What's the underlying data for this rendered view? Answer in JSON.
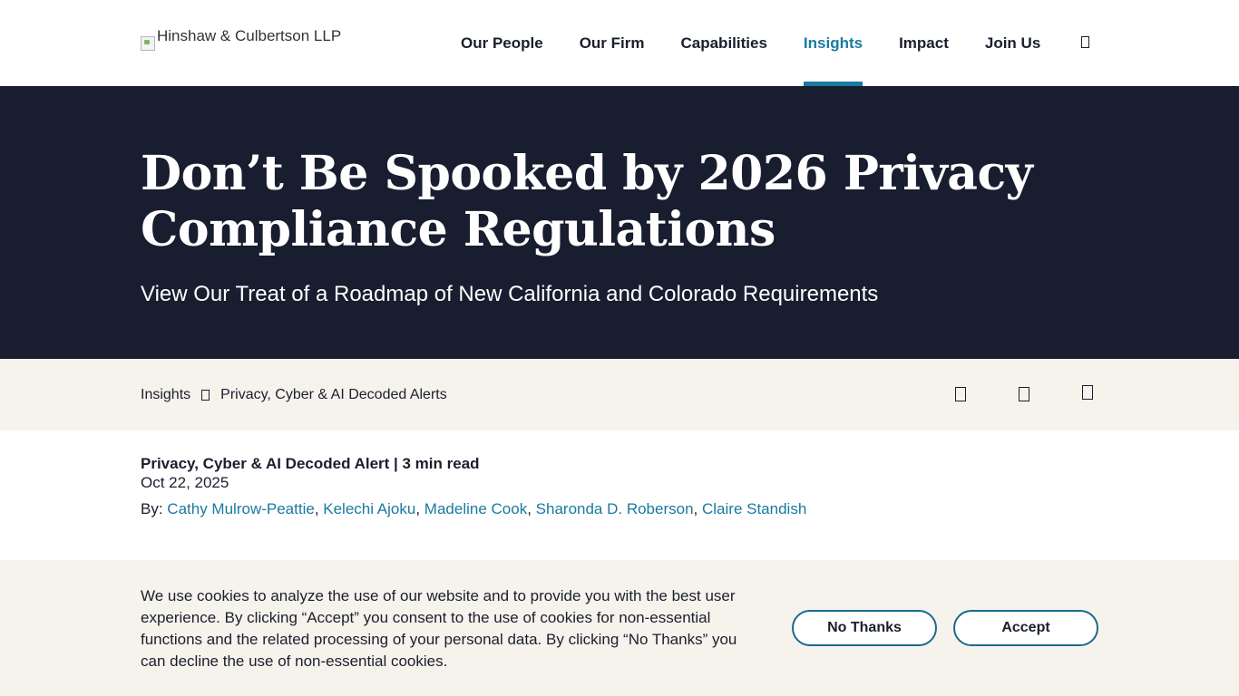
{
  "header": {
    "logo_alt": "Hinshaw & Culbertson LLP",
    "nav": [
      {
        "label": "Our People",
        "active": false
      },
      {
        "label": "Our Firm",
        "active": false
      },
      {
        "label": "Capabilities",
        "active": false
      },
      {
        "label": "Insights",
        "active": true
      },
      {
        "label": "Impact",
        "active": false
      },
      {
        "label": "Join Us",
        "active": false
      }
    ],
    "search_icon": "search-icon"
  },
  "hero": {
    "title": "Don’t Be Spooked by 2026 Privacy Compliance Regulations",
    "subtitle": "View Our Treat of a Roadmap of New California and Colorado Requirements"
  },
  "breadcrumb": {
    "items": [
      "Insights",
      "Privacy, Cyber & AI Decoded Alerts"
    ]
  },
  "share_icons": [
    "share-icon",
    "share-icon",
    "share-icon"
  ],
  "article": {
    "type_line": "Privacy, Cyber & AI Decoded Alert | 3 min read",
    "date": "Oct 22, 2025",
    "by_label": "By:",
    "authors": [
      "Cathy Mulrow-Peattie",
      "Kelechi Ajoku",
      "Madeline Cook",
      "Sharonda D. Roberson",
      "Claire Standish"
    ]
  },
  "cookie_banner": {
    "text": "We use cookies to analyze the use of our website and to provide you with the best user experience. By clicking “Accept” you consent to the use of cookies for non-essential functions and the related processing of your personal data. By clicking “No Thanks” you can decline the use of non-essential cookies.",
    "no_thanks_label": "No Thanks",
    "accept_label": "Accept"
  },
  "colors": {
    "accent": "#1a7aa0",
    "hero_bg": "#181d2f",
    "band_bg": "#f6f3ec"
  }
}
